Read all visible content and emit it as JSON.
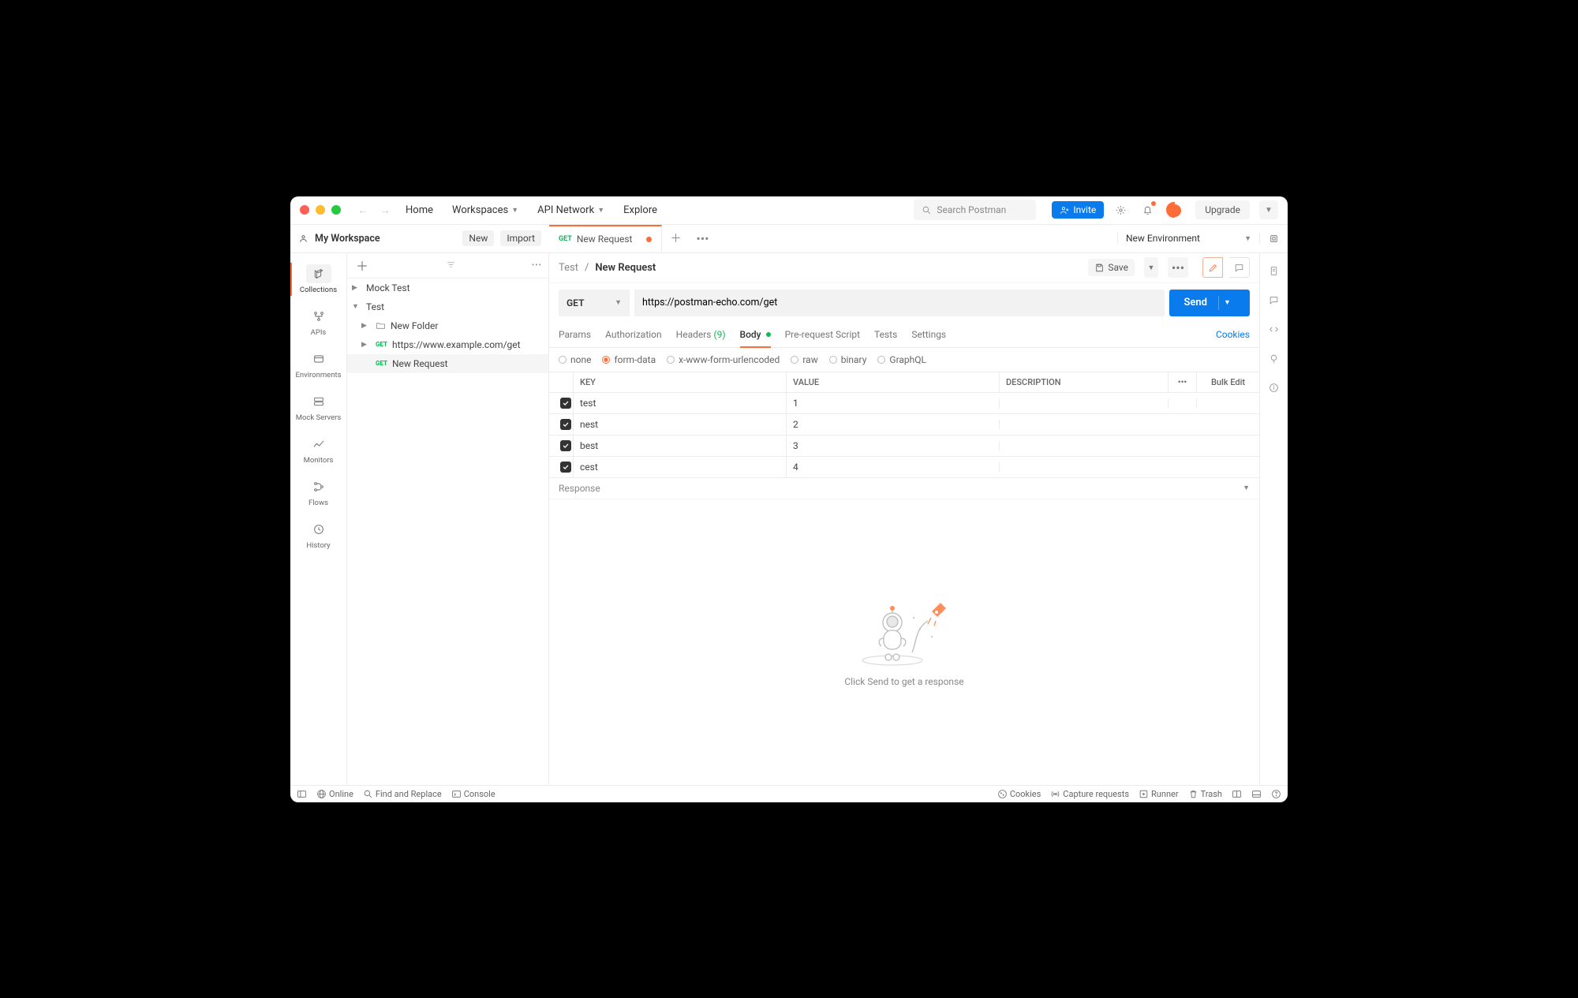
{
  "titlebar": {
    "home": "Home",
    "workspaces": "Workspaces",
    "api_network": "API Network",
    "explore": "Explore",
    "search_placeholder": "Search Postman",
    "invite": "Invite",
    "upgrade": "Upgrade"
  },
  "workspace": {
    "name": "My Workspace",
    "new_btn": "New",
    "import_btn": "Import"
  },
  "tabs": {
    "active_method": "GET",
    "active_label": "New Request"
  },
  "environment": {
    "selected": "New Environment"
  },
  "rail": {
    "collections": "Collections",
    "apis": "APIs",
    "environments": "Environments",
    "mock_servers": "Mock Servers",
    "monitors": "Monitors",
    "flows": "Flows",
    "history": "History"
  },
  "tree": {
    "items": [
      {
        "label": "Mock Test"
      },
      {
        "label": "Test"
      },
      {
        "label": "New Folder"
      },
      {
        "method": "GET",
        "label": "https://www.example.com/get"
      },
      {
        "method": "GET",
        "label": "New Request"
      }
    ]
  },
  "breadcrumb": {
    "parent": "Test",
    "current": "New Request",
    "save": "Save"
  },
  "request": {
    "method": "GET",
    "url": "https://postman-echo.com/get",
    "send": "Send"
  },
  "req_tabs": {
    "params": "Params",
    "authorization": "Authorization",
    "headers": "Headers",
    "headers_count": "(9)",
    "body": "Body",
    "prerequest": "Pre-request Script",
    "tests": "Tests",
    "settings": "Settings",
    "cookies": "Cookies"
  },
  "body_types": {
    "none": "none",
    "formdata": "form-data",
    "xwww": "x-www-form-urlencoded",
    "raw": "raw",
    "binary": "binary",
    "graphql": "GraphQL"
  },
  "kv": {
    "key_h": "KEY",
    "val_h": "VALUE",
    "desc_h": "DESCRIPTION",
    "bulk": "Bulk Edit",
    "rows": [
      {
        "key": "test",
        "value": "1"
      },
      {
        "key": "nest",
        "value": "2"
      },
      {
        "key": "best",
        "value": "3"
      },
      {
        "key": "cest",
        "value": "4"
      }
    ]
  },
  "response": {
    "label": "Response",
    "hint": "Click Send to get a response"
  },
  "status": {
    "online": "Online",
    "find": "Find and Replace",
    "console": "Console",
    "cookies": "Cookies",
    "capture": "Capture requests",
    "runner": "Runner",
    "trash": "Trash"
  }
}
